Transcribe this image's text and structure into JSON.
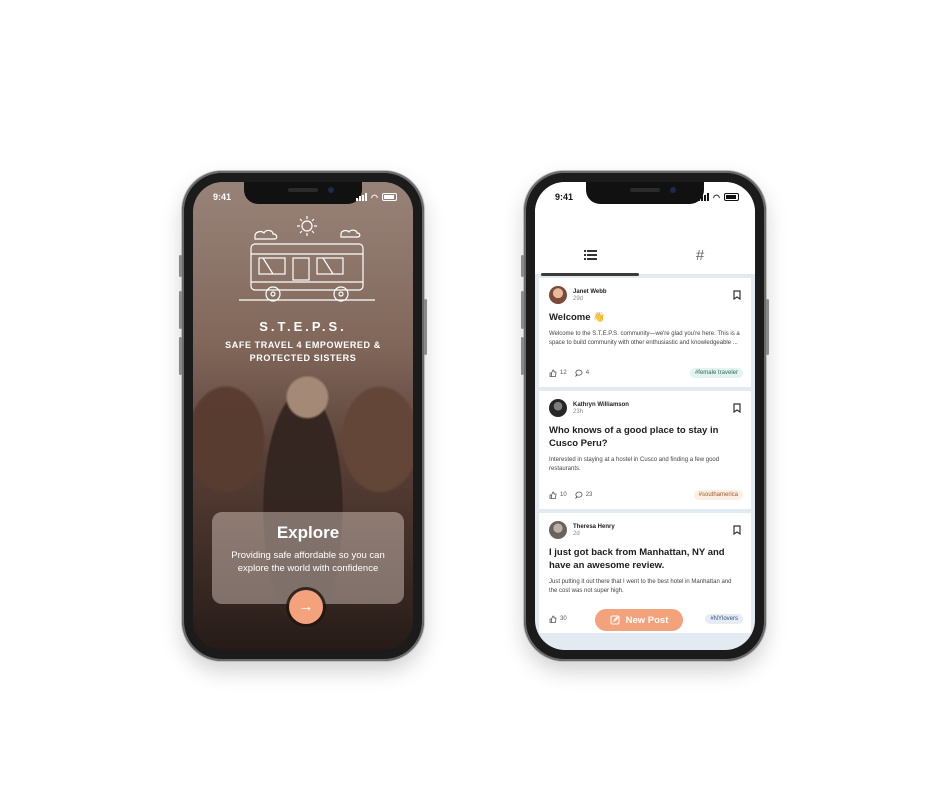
{
  "left_phone": {
    "status_time": "9:41",
    "brand": "S.T.E.P.S.",
    "tagline": "SAFE TRAVEL 4 EMPOWERED & PROTECTED SISTERS",
    "card_title": "Explore",
    "card_text": "Providing safe affordable so you can explore the world with confidence",
    "arrow_icon": "arrow-right-icon"
  },
  "right_phone": {
    "status_time": "9:41",
    "tabs": [
      {
        "icon": "list-icon",
        "active": true
      },
      {
        "icon": "hash-icon",
        "active": false
      }
    ],
    "posts": [
      {
        "author": "Janet Webb",
        "time": "29d",
        "title": "Welcome 👋",
        "body": "Welcome to the S.T.E.P.S. community—we're glad you're here. This is a space to build community with other enthusiastic and knowledgeable ...",
        "likes": "12",
        "comments": "4",
        "tag": "#female traveler",
        "tag_bg": "#e3f3ef",
        "tag_fg": "#2e6b5c"
      },
      {
        "author": "Kathryn Williamson",
        "time": "23h",
        "title": "Who knows of a good place to stay in Cusco Peru?",
        "body": "Interested in staying at a hostel in Cusco and finding a few good restaurants.",
        "likes": "10",
        "comments": "23",
        "tag": "#southamerica",
        "tag_bg": "#fbeee2",
        "tag_fg": "#9a5a2a"
      },
      {
        "author": "Theresa Henry",
        "time": "2d",
        "title": "I just got back from Manhattan, NY and have an awesome review.",
        "body": "Just putting it out there that I went to the best hotel in Manhattan and the cost was not super high.",
        "likes": "30",
        "comments": "",
        "tag": "#NYlovers",
        "tag_bg": "#e6ecf6",
        "tag_fg": "#34507a"
      }
    ],
    "new_post_label": "New Post",
    "accent": "#f4a27b"
  }
}
